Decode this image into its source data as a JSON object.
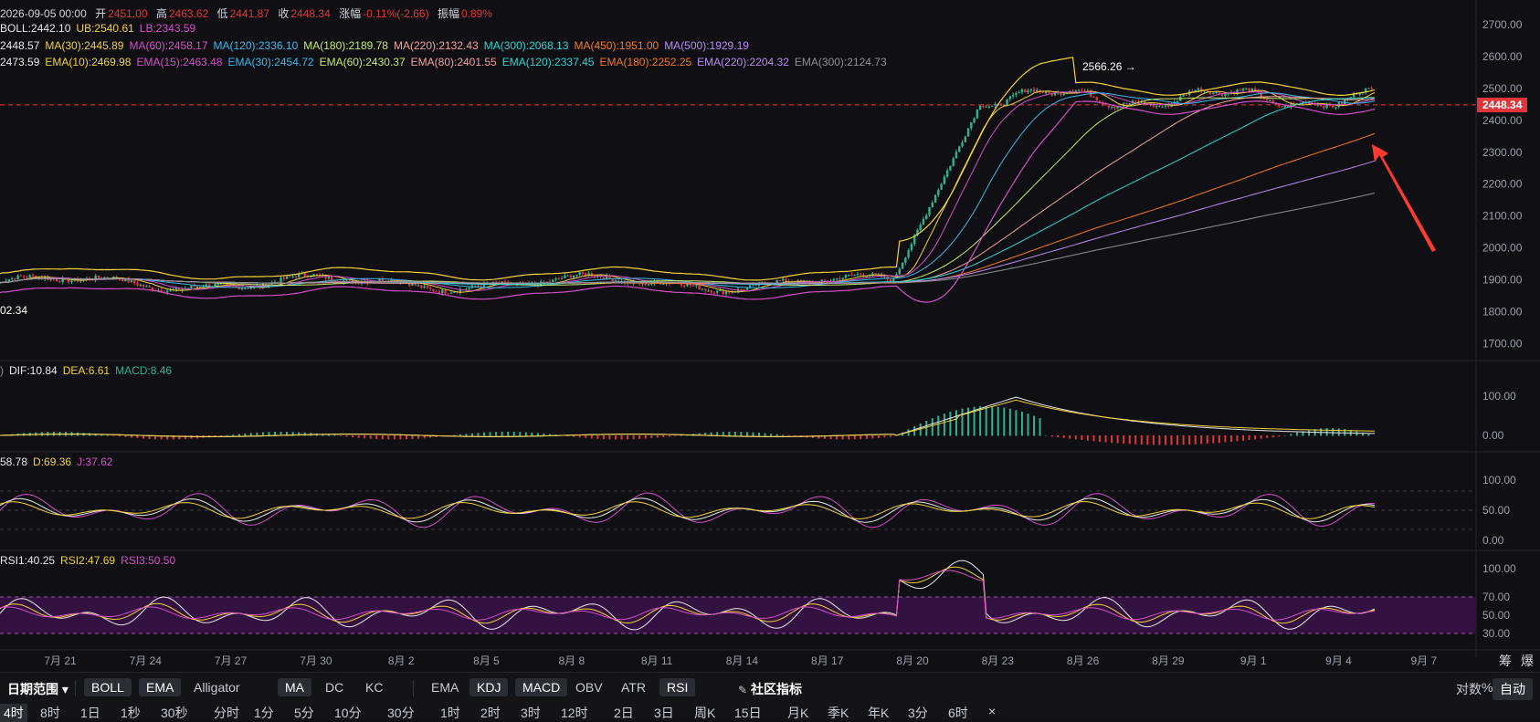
{
  "header": {
    "ohlc": {
      "date": "2026-09-05 00:00",
      "open_label": "开",
      "open": "2451.00",
      "high_label": "高",
      "high": "2463.62",
      "low_label": "低",
      "low": "2441.87",
      "close_label": "收",
      "close": "2448.34",
      "chg_label": "涨幅",
      "chg": "-0.11%(-2.66)",
      "amp_label": "振幅",
      "amp": "0.89%"
    },
    "boll": [
      {
        "t": "BOLL:2442.10",
        "c": "#e8e8e8"
      },
      {
        "t": "UB:2540.61",
        "c": "#f2d13b"
      },
      {
        "t": "LB:2343.59",
        "c": "#d04fc6"
      }
    ],
    "ma": [
      {
        "t": "2448.57",
        "c": "#e8e8e8"
      },
      {
        "t": "MA(30):2445.89",
        "c": "#f2d13b"
      },
      {
        "t": "MA(60):2458.17",
        "c": "#d04fc6"
      },
      {
        "t": "MA(120):2336.10",
        "c": "#3db7e8"
      },
      {
        "t": "MA(180):2189.78",
        "c": "#c5e86a"
      },
      {
        "t": "MA(220):2132.43",
        "c": "#f0a0a0"
      },
      {
        "t": "MA(300):2068.13",
        "c": "#2ad4d4"
      },
      {
        "t": "MA(450):1951.00",
        "c": "#f07a1e"
      },
      {
        "t": "MA(500):1929.19",
        "c": "#b88cf0"
      }
    ],
    "ema": [
      {
        "t": "2473.59",
        "c": "#e8e8e8"
      },
      {
        "t": "EMA(10):2469.98",
        "c": "#f2d13b"
      },
      {
        "t": "EMA(15):2463.48",
        "c": "#d04fc6"
      },
      {
        "t": "EMA(30):2454.72",
        "c": "#3db7e8"
      },
      {
        "t": "EMA(60):2430.37",
        "c": "#c5e86a"
      },
      {
        "t": "EMA(80):2401.55",
        "c": "#f0a0a0"
      },
      {
        "t": "EMA(120):2337.45",
        "c": "#2ad4d4"
      },
      {
        "t": "EMA(180):2252.25",
        "c": "#f07a1e"
      },
      {
        "t": "EMA(220):2204.32",
        "c": "#b88cf0"
      },
      {
        "t": "EMA(300):2124.73",
        "c": "#8e8e96"
      }
    ],
    "macd": [
      {
        "t": ")",
        "c": "#8e8e96"
      },
      {
        "t": "DIF:10.84",
        "c": "#e8e8e8"
      },
      {
        "t": "DEA:6.61",
        "c": "#f2d13b"
      },
      {
        "t": "MACD:8.46",
        "c": "#2fb38c"
      }
    ],
    "kdj": [
      {
        "t": "58.78",
        "c": "#e8e8e8"
      },
      {
        "t": "D:69.36",
        "c": "#f2d13b"
      },
      {
        "t": "J:37.62",
        "c": "#d04fc6"
      }
    ],
    "rsi": [
      {
        "t": "RSI1:40.25",
        "c": "#e8e8e8"
      },
      {
        "t": "RSI2:47.69",
        "c": "#f2d13b"
      },
      {
        "t": "RSI3:50.50",
        "c": "#d04fc6"
      }
    ]
  },
  "price_axis": {
    "labels": [
      "2700.00",
      "2600.00",
      "2500.00",
      "2400.00",
      "2300.00",
      "2200.00",
      "2100.00",
      "2000.00",
      "1900.00",
      "1800.00",
      "1700.00"
    ],
    "last_price": "2448.34",
    "peak_label": "2566.26 →",
    "left_price": "02.34"
  },
  "macd_axis": [
    "100.00",
    "0.00"
  ],
  "kdj_axis": [
    "100.00",
    "50.00",
    "0.00"
  ],
  "rsi_axis": [
    "100.00",
    "70.00",
    "50.00",
    "30.00"
  ],
  "dates": [
    "7月 21",
    "7月 24",
    "7月 27",
    "7月 30",
    "8月 2",
    "8月 5",
    "8月 8",
    "8月 11",
    "8月 14",
    "8月 17",
    "8月 20",
    "8月 23",
    "8月 26",
    "8月 29",
    "9月 1",
    "9月 4",
    "9月 7"
  ],
  "corner_labels": [
    "筹",
    "爆"
  ],
  "toolbar1": {
    "range": "日期范围",
    "indicators": [
      {
        "t": "BOLL",
        "on": true
      },
      {
        "t": "EMA",
        "on": true
      },
      {
        "t": "Alligator",
        "on": false
      },
      {
        "t": "MA",
        "on": true
      },
      {
        "t": "DC",
        "on": false
      },
      {
        "t": "KC",
        "on": false
      }
    ],
    "sub": [
      {
        "t": "EMA",
        "on": false
      },
      {
        "t": "KDJ",
        "on": true
      },
      {
        "t": "MACD",
        "on": true
      },
      {
        "t": "OBV",
        "on": false
      },
      {
        "t": "ATR",
        "on": false
      },
      {
        "t": "RSI",
        "on": true
      }
    ],
    "community": "社区指标",
    "right": [
      {
        "t": "对数",
        "on": false
      },
      {
        "t": "%",
        "on": false
      },
      {
        "t": "自动",
        "on": true
      }
    ]
  },
  "toolbar2": {
    "items": [
      "4时",
      "8时",
      "1日",
      "1秒",
      "30秒",
      "分时",
      "1分",
      "5分",
      "10分",
      "30分",
      "1时",
      "2时",
      "3时",
      "12时",
      "2日",
      "3日",
      "周K",
      "15日",
      "月K",
      "季K",
      "年K",
      "3分",
      "6时",
      "×"
    ]
  },
  "colors": {
    "up": "#2fb38c",
    "down": "#e0363b",
    "bg": "#101014",
    "arrow": "#ff3b30"
  }
}
